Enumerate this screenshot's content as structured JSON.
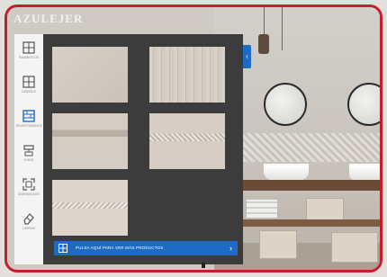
{
  "brand": {
    "logo_text": "AZULEJER"
  },
  "sidebar": {
    "items": [
      {
        "icon": "floor-plan-icon",
        "caption": "PAVIMENTOS",
        "active": false
      },
      {
        "icon": "grid-icon",
        "caption": "DISEÑOS",
        "active": false
      },
      {
        "icon": "wall-tiles-icon",
        "caption": "REVESTIMIENTO",
        "active": true
      },
      {
        "icon": "paint-roller-icon",
        "caption": "JUNTA",
        "active": false
      },
      {
        "icon": "expand-icon",
        "caption": "DIMENSIONES",
        "active": false
      },
      {
        "icon": "eraser-icon",
        "caption": "LIMPIAR",
        "active": false
      }
    ]
  },
  "tiles": [
    {
      "style": "plain-beige"
    },
    {
      "style": "vertical-stripes"
    },
    {
      "style": "horizontal-band"
    },
    {
      "style": "decor-band"
    },
    {
      "style": "decor-row"
    }
  ],
  "footer": {
    "label": "PULSA AQUÍ PARA VER MÁS PRODUCTOS"
  },
  "colors": {
    "frame": "#c41f2c",
    "accent": "#1e6bc4",
    "panel": "#3c3c3c"
  }
}
